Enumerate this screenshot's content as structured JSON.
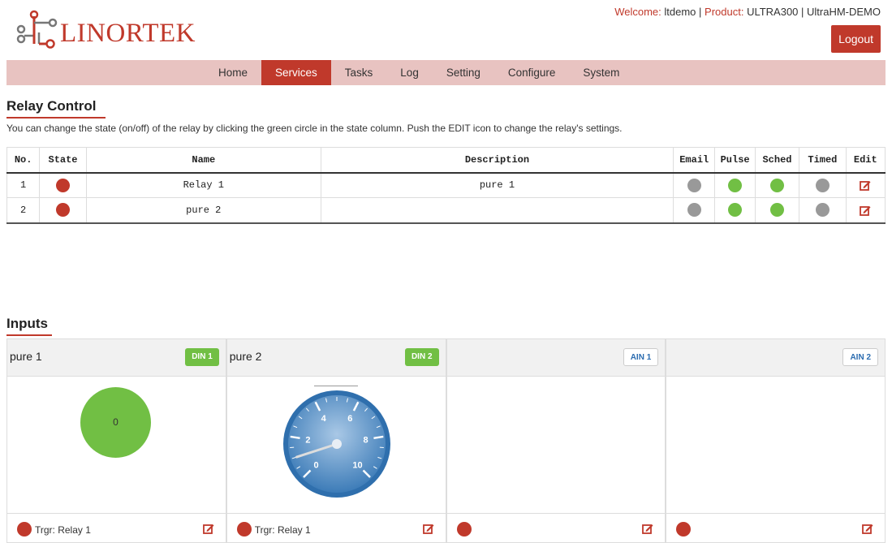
{
  "header": {
    "logo_text": "LINORTEK",
    "welcome_label": "Welcome: ",
    "welcome_user": "ltdemo",
    "product_label": "Product: ",
    "product_value": "ULTRA300 | UltraHM-DEMO",
    "separator": " | ",
    "logout_label": "Logout",
    "brand_color": "#c0392b"
  },
  "nav": {
    "items": [
      "Home",
      "Services",
      "Tasks",
      "Log",
      "Setting",
      "Configure",
      "System"
    ],
    "active": "Services"
  },
  "relay": {
    "title": "Relay Control",
    "description": "You can change the state (on/off) of the relay by clicking the green circle in the state column. Push the EDIT icon to change the relay's settings.",
    "columns": [
      "No.",
      "State",
      "Name",
      "Description",
      "Email",
      "Pulse",
      "Sched",
      "Timed",
      "Edit"
    ],
    "rows": [
      {
        "no": "1",
        "state": "red",
        "name": "Relay 1",
        "description": "pure 1",
        "email": "grey",
        "pulse": "green",
        "sched": "green",
        "timed": "grey"
      },
      {
        "no": "2",
        "state": "red",
        "name": "pure 2",
        "description": "",
        "email": "grey",
        "pulse": "green",
        "sched": "green",
        "timed": "grey"
      }
    ]
  },
  "inputs": {
    "title": "Inputs",
    "panels": [
      {
        "title": "pure 1",
        "badge": "DIN 1",
        "badge_type": "din",
        "value": "0",
        "trigger": "Trgr: Relay 1"
      },
      {
        "title": "pure 2",
        "badge": "DIN 2",
        "badge_type": "din",
        "gauge_labels": [
          "0",
          "2",
          "4",
          "6",
          "8",
          "10"
        ],
        "gauge_value": 1,
        "trigger": "Trgr: Relay 1"
      },
      {
        "title": "",
        "badge": "AIN 1",
        "badge_type": "ain",
        "trigger": ""
      },
      {
        "title": "",
        "badge": "AIN 2",
        "badge_type": "ain",
        "trigger": ""
      }
    ]
  },
  "icons": {
    "logo": "linortek-logo-icon",
    "edit": "edit-icon"
  }
}
